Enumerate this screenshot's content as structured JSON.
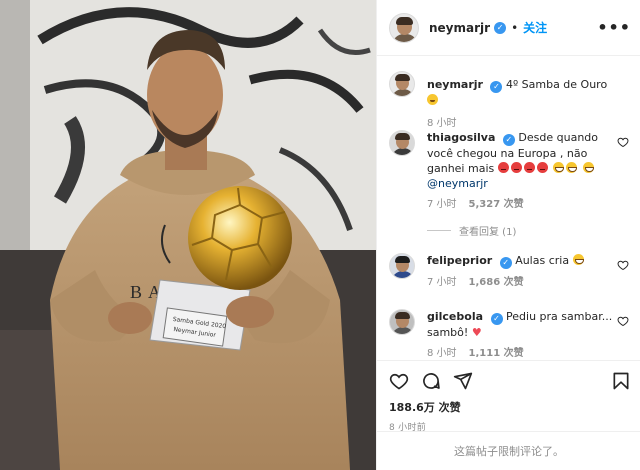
{
  "post": {
    "author": "neymarjr",
    "verified_mark": "✓",
    "separator": "•",
    "follow_label": "关注",
    "more_label": "•••",
    "caption_user": "neymarjr",
    "caption_text": "4º Samba de Ouro",
    "caption_time": "8 小时",
    "trophy_plate_lines": [
      "Samba Gold 2020",
      "Neymar Junior"
    ],
    "sweater_text": "BALEN"
  },
  "comments": [
    {
      "user": "thiagosilva",
      "text": "Desde quando você chegou na Europa , não ganhei mais",
      "mention": "@neymarjr",
      "time": "7 小时",
      "likes": "5,327 次赞",
      "replies": "查看回复 (1)"
    },
    {
      "user": "felipeprior",
      "text": "Aulas cria",
      "time": "7 小时",
      "likes": "1,686 次赞"
    },
    {
      "user": "gilcebola",
      "text": "Pediu pra sambar... sambô!",
      "time": "8 小时",
      "likes": "1,111 次赞"
    }
  ],
  "actions": {
    "like_count": "188.6万 次赞",
    "posted_time": "8 小时前",
    "comments_limited": "这篇帖子限制评论了。"
  },
  "icons": {
    "verified": "verified-badge-icon",
    "more": "more-options-icon",
    "like": "heart-icon",
    "comment": "comment-icon",
    "share": "share-icon",
    "save": "bookmark-icon",
    "comment_like": "heart-small-icon"
  },
  "colors": {
    "accent": "#0095f6",
    "verified": "#3897f0",
    "muted": "#8e8e8e",
    "heart": "#ed4956"
  }
}
